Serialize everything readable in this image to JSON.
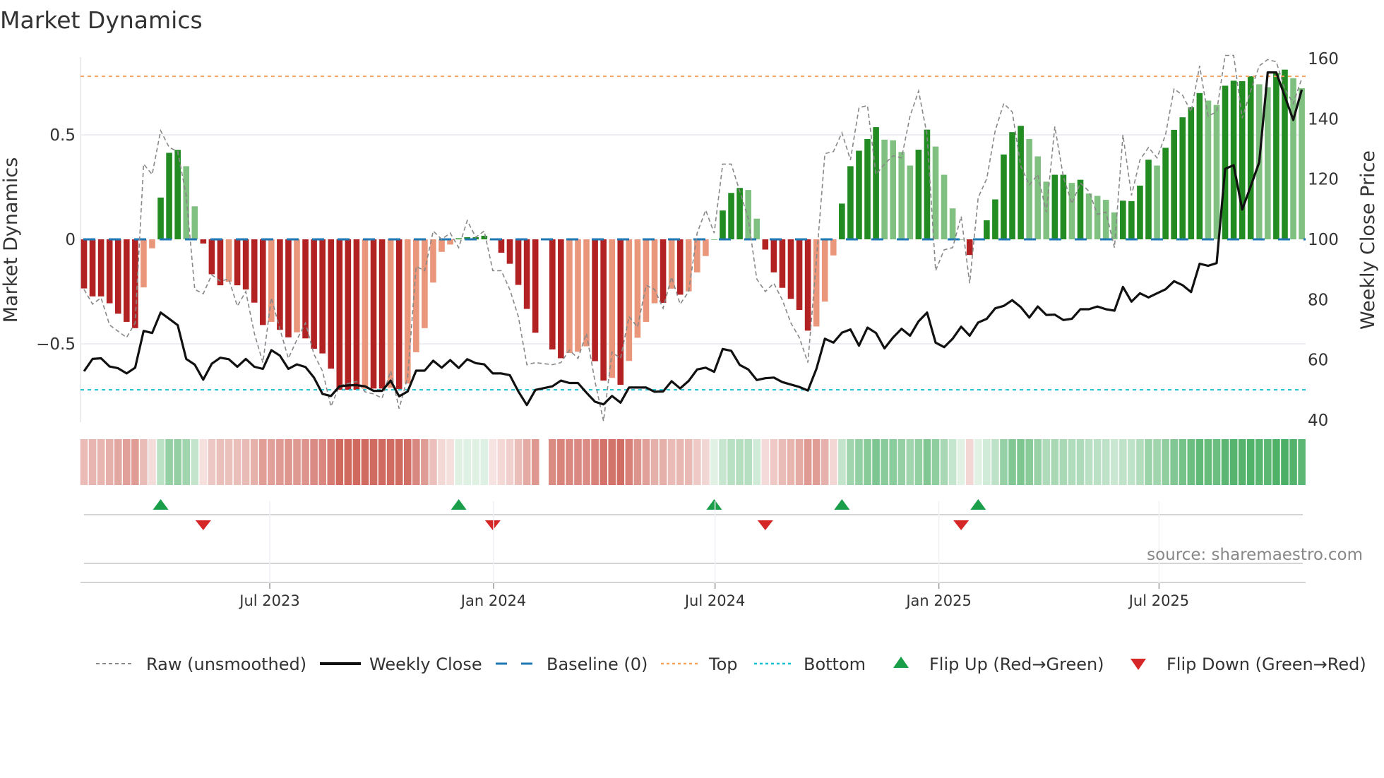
{
  "chart_data": {
    "type": "bar",
    "title": "Market Dynamics",
    "ylabel": "Market Dynamics",
    "y2label": "Weekly Close Price",
    "ylim": [
      -0.84,
      0.9
    ],
    "y2lim": [
      40,
      160
    ],
    "yticks": [
      {
        "v": 0.5,
        "label": "0.5"
      },
      {
        "v": 0,
        "label": "0"
      },
      {
        "v": -0.5,
        "label": "−0.5"
      }
    ],
    "y2ticks": [
      {
        "v": 160,
        "label": "160"
      },
      {
        "v": 140,
        "label": "140"
      },
      {
        "v": 120,
        "label": "120"
      },
      {
        "v": 100,
        "label": "100"
      },
      {
        "v": 80,
        "label": "80"
      },
      {
        "v": 60,
        "label": "60"
      },
      {
        "v": 40,
        "label": "40"
      }
    ],
    "xticks": [
      {
        "date": "2023-07-01",
        "label": "Jul 2023"
      },
      {
        "date": "2024-01-01",
        "label": "Jan 2024"
      },
      {
        "date": "2024-07-01",
        "label": "Jul 2024"
      },
      {
        "date": "2025-01-01",
        "label": "Jan 2025"
      },
      {
        "date": "2025-07-01",
        "label": "Jul 2025"
      }
    ],
    "start_week": "2023-01-27",
    "interval": "weekly",
    "top_level": 0.78,
    "bottom_level": -0.72,
    "baseline": 0,
    "smoothed": [
      -0.235,
      -0.273,
      -0.273,
      -0.306,
      -0.356,
      -0.395,
      -0.425,
      -0.23,
      -0.043,
      0.2,
      0.414,
      0.428,
      0.35,
      0.158,
      -0.02,
      -0.167,
      -0.22,
      -0.203,
      -0.22,
      -0.24,
      -0.303,
      -0.41,
      -0.395,
      -0.433,
      -0.469,
      -0.445,
      -0.474,
      -0.524,
      -0.546,
      -0.619,
      -0.72,
      -0.72,
      -0.72,
      -0.715,
      -0.714,
      -0.714,
      -0.71,
      -0.716,
      -0.69,
      -0.54,
      -0.425,
      -0.207,
      -0.06,
      -0.025,
      0.005,
      0.01,
      0.01,
      0.017,
      -0.005,
      -0.064,
      -0.117,
      -0.218,
      -0.333,
      -0.447,
      null,
      -0.527,
      -0.569,
      -0.544,
      -0.538,
      -0.512,
      -0.583,
      -0.676,
      -0.663,
      -0.696,
      -0.582,
      -0.471,
      -0.395,
      -0.306,
      -0.304,
      -0.236,
      -0.265,
      -0.249,
      -0.158,
      -0.08,
      0.0,
      0.138,
      0.222,
      0.246,
      0.236,
      0.099,
      -0.049,
      -0.158,
      -0.232,
      -0.285,
      -0.338,
      -0.437,
      -0.417,
      -0.298,
      -0.077,
      0.171,
      0.35,
      0.424,
      0.48,
      0.537,
      0.477,
      0.474,
      0.418,
      0.353,
      0.429,
      0.525,
      0.444,
      0.309,
      0.148,
      0.0,
      -0.075,
      0.0,
      0.091,
      0.191,
      0.406,
      0.513,
      0.543,
      0.48,
      0.397,
      0.276,
      0.309,
      0.309,
      0.27,
      0.285,
      0.219,
      0.208,
      0.189,
      0.129,
      0.185,
      0.183,
      0.257,
      0.381,
      0.353,
      0.438,
      0.524,
      0.584,
      0.632,
      0.7,
      0.664,
      0.643,
      0.735,
      0.759,
      0.757,
      0.78,
      0.742,
      0.728,
      0.795,
      0.812,
      0.771,
      0.723
    ],
    "raw": [
      -0.24,
      -0.31,
      -0.28,
      -0.41,
      -0.44,
      -0.47,
      -0.4,
      0.36,
      0.31,
      0.52,
      0.44,
      0.42,
      0.21,
      -0.24,
      -0.26,
      -0.17,
      -0.2,
      -0.19,
      -0.32,
      -0.25,
      -0.45,
      -0.59,
      -0.28,
      -0.43,
      -0.57,
      -0.48,
      -0.4,
      -0.55,
      -0.63,
      -0.8,
      -0.7,
      -0.69,
      -0.68,
      -0.73,
      -0.74,
      -0.76,
      -0.63,
      -0.81,
      -0.66,
      -0.13,
      -0.15,
      0.04,
      0.0,
      0.03,
      -0.04,
      0.09,
      0.01,
      0.04,
      -0.15,
      -0.15,
      -0.24,
      -0.37,
      -0.6,
      -0.59,
      null,
      -0.6,
      -0.59,
      -0.53,
      -0.57,
      -0.45,
      -0.68,
      -0.87,
      -0.54,
      -0.57,
      -0.37,
      -0.42,
      -0.22,
      -0.24,
      -0.33,
      -0.18,
      -0.31,
      -0.25,
      0.03,
      0.14,
      0.03,
      0.36,
      0.36,
      0.23,
      0.1,
      -0.19,
      -0.25,
      -0.21,
      -0.29,
      -0.4,
      -0.47,
      -0.59,
      -0.1,
      0.41,
      0.42,
      0.51,
      0.38,
      0.63,
      0.64,
      0.31,
      0.36,
      0.4,
      0.39,
      0.59,
      0.71,
      0.5,
      -0.15,
      -0.05,
      -0.04,
      0.11,
      -0.21,
      0.2,
      0.29,
      0.52,
      0.65,
      0.61,
      0.35,
      0.26,
      0.31,
      0.13,
      0.54,
      0.3,
      0.17,
      0.27,
      0.23,
      0.12,
      0.13,
      -0.04,
      0.5,
      0.21,
      0.38,
      0.44,
      0.39,
      0.5,
      0.72,
      0.69,
      0.61,
      0.83,
      0.59,
      0.61,
      0.88,
      0.88,
      0.58,
      0.71,
      0.83,
      0.86,
      0.85,
      0.72,
      0.65,
      0.77
    ],
    "close": [
      56.2,
      60.3,
      60.5,
      57.8,
      57.2,
      55.5,
      57.4,
      69.6,
      68.9,
      75.7,
      73.6,
      71.5,
      60.3,
      58.4,
      53.4,
      58.7,
      60.7,
      60.2,
      57.7,
      60.3,
      57.7,
      57.0,
      63.2,
      61.4,
      57.0,
      58.5,
      57.6,
      54.1,
      48.7,
      48.0,
      51.2,
      51.5,
      51.6,
      51.2,
      49.7,
      49.7,
      53.1,
      47.9,
      49.5,
      56.4,
      56.4,
      59.7,
      57.4,
      59.9,
      57.3,
      60.2,
      58.9,
      58.5,
      55.5,
      55.5,
      54.9,
      49.5,
      45.0,
      50.0,
      null,
      51.2,
      53.1,
      52.3,
      52.3,
      49.1,
      46.1,
      45.2,
      48.0,
      45.8,
      50.8,
      50.8,
      50.8,
      49.4,
      49.5,
      52.9,
      50.5,
      53.0,
      56.8,
      57.4,
      56.0,
      63.6,
      63.0,
      58.3,
      56.8,
      53.3,
      53.9,
      54.1,
      52.6,
      51.8,
      51.0,
      49.8,
      57.0,
      67.0,
      65.7,
      69.0,
      70.1,
      64.7,
      70.7,
      68.9,
      63.8,
      67.4,
      70.3,
      68.0,
      72.8,
      75.7,
      65.7,
      64.2,
      67.0,
      71.0,
      68.0,
      72.4,
      73.6,
      77.1,
      77.9,
      79.8,
      77.5,
      74.0,
      77.7,
      74.9,
      75.0,
      73.2,
      73.6,
      76.8,
      76.8,
      77.7,
      76.8,
      76.3,
      84.2,
      79.3,
      82.1,
      80.7,
      82.1,
      83.4,
      86.1,
      84.8,
      82.5,
      91.9,
      91.2,
      92.1,
      123.4,
      124.6,
      109.9,
      117.6,
      125.6,
      155.4,
      155.4,
      147.5,
      139.6,
      149.7
    ],
    "flip_up": [
      "2023-03-31",
      "2023-12-01",
      "2024-06-28",
      "2024-10-11",
      "2025-01-31"
    ],
    "flip_down": [
      "2023-05-05",
      "2023-12-29",
      "2024-08-09",
      "2025-01-17"
    ],
    "legend": {
      "placement": "bottom",
      "items": [
        {
          "key": "raw",
          "label": "Raw (unsmoothed)"
        },
        {
          "key": "close",
          "label": "Weekly Close"
        },
        {
          "key": "baseline",
          "label": "Baseline (0)"
        },
        {
          "key": "top",
          "label": "Top"
        },
        {
          "key": "bottom",
          "label": "Bottom"
        },
        {
          "key": "up",
          "label": "Flip Up (Red→Green)"
        },
        {
          "key": "down",
          "label": "Flip Down (Green→Red)"
        }
      ]
    },
    "source": "source: sharemaestro.com",
    "colors": {
      "red_strong": "#b22222",
      "red_weak": "#e9967a",
      "green_strong": "#228b22",
      "green_weak": "#80c080",
      "baseline": "#1f77b4",
      "top": "#f4a460",
      "bottom": "#17becf",
      "raw": "#888888",
      "close": "#111111",
      "flip_up": "#1a9e4a",
      "flip_down": "#d62728"
    }
  }
}
